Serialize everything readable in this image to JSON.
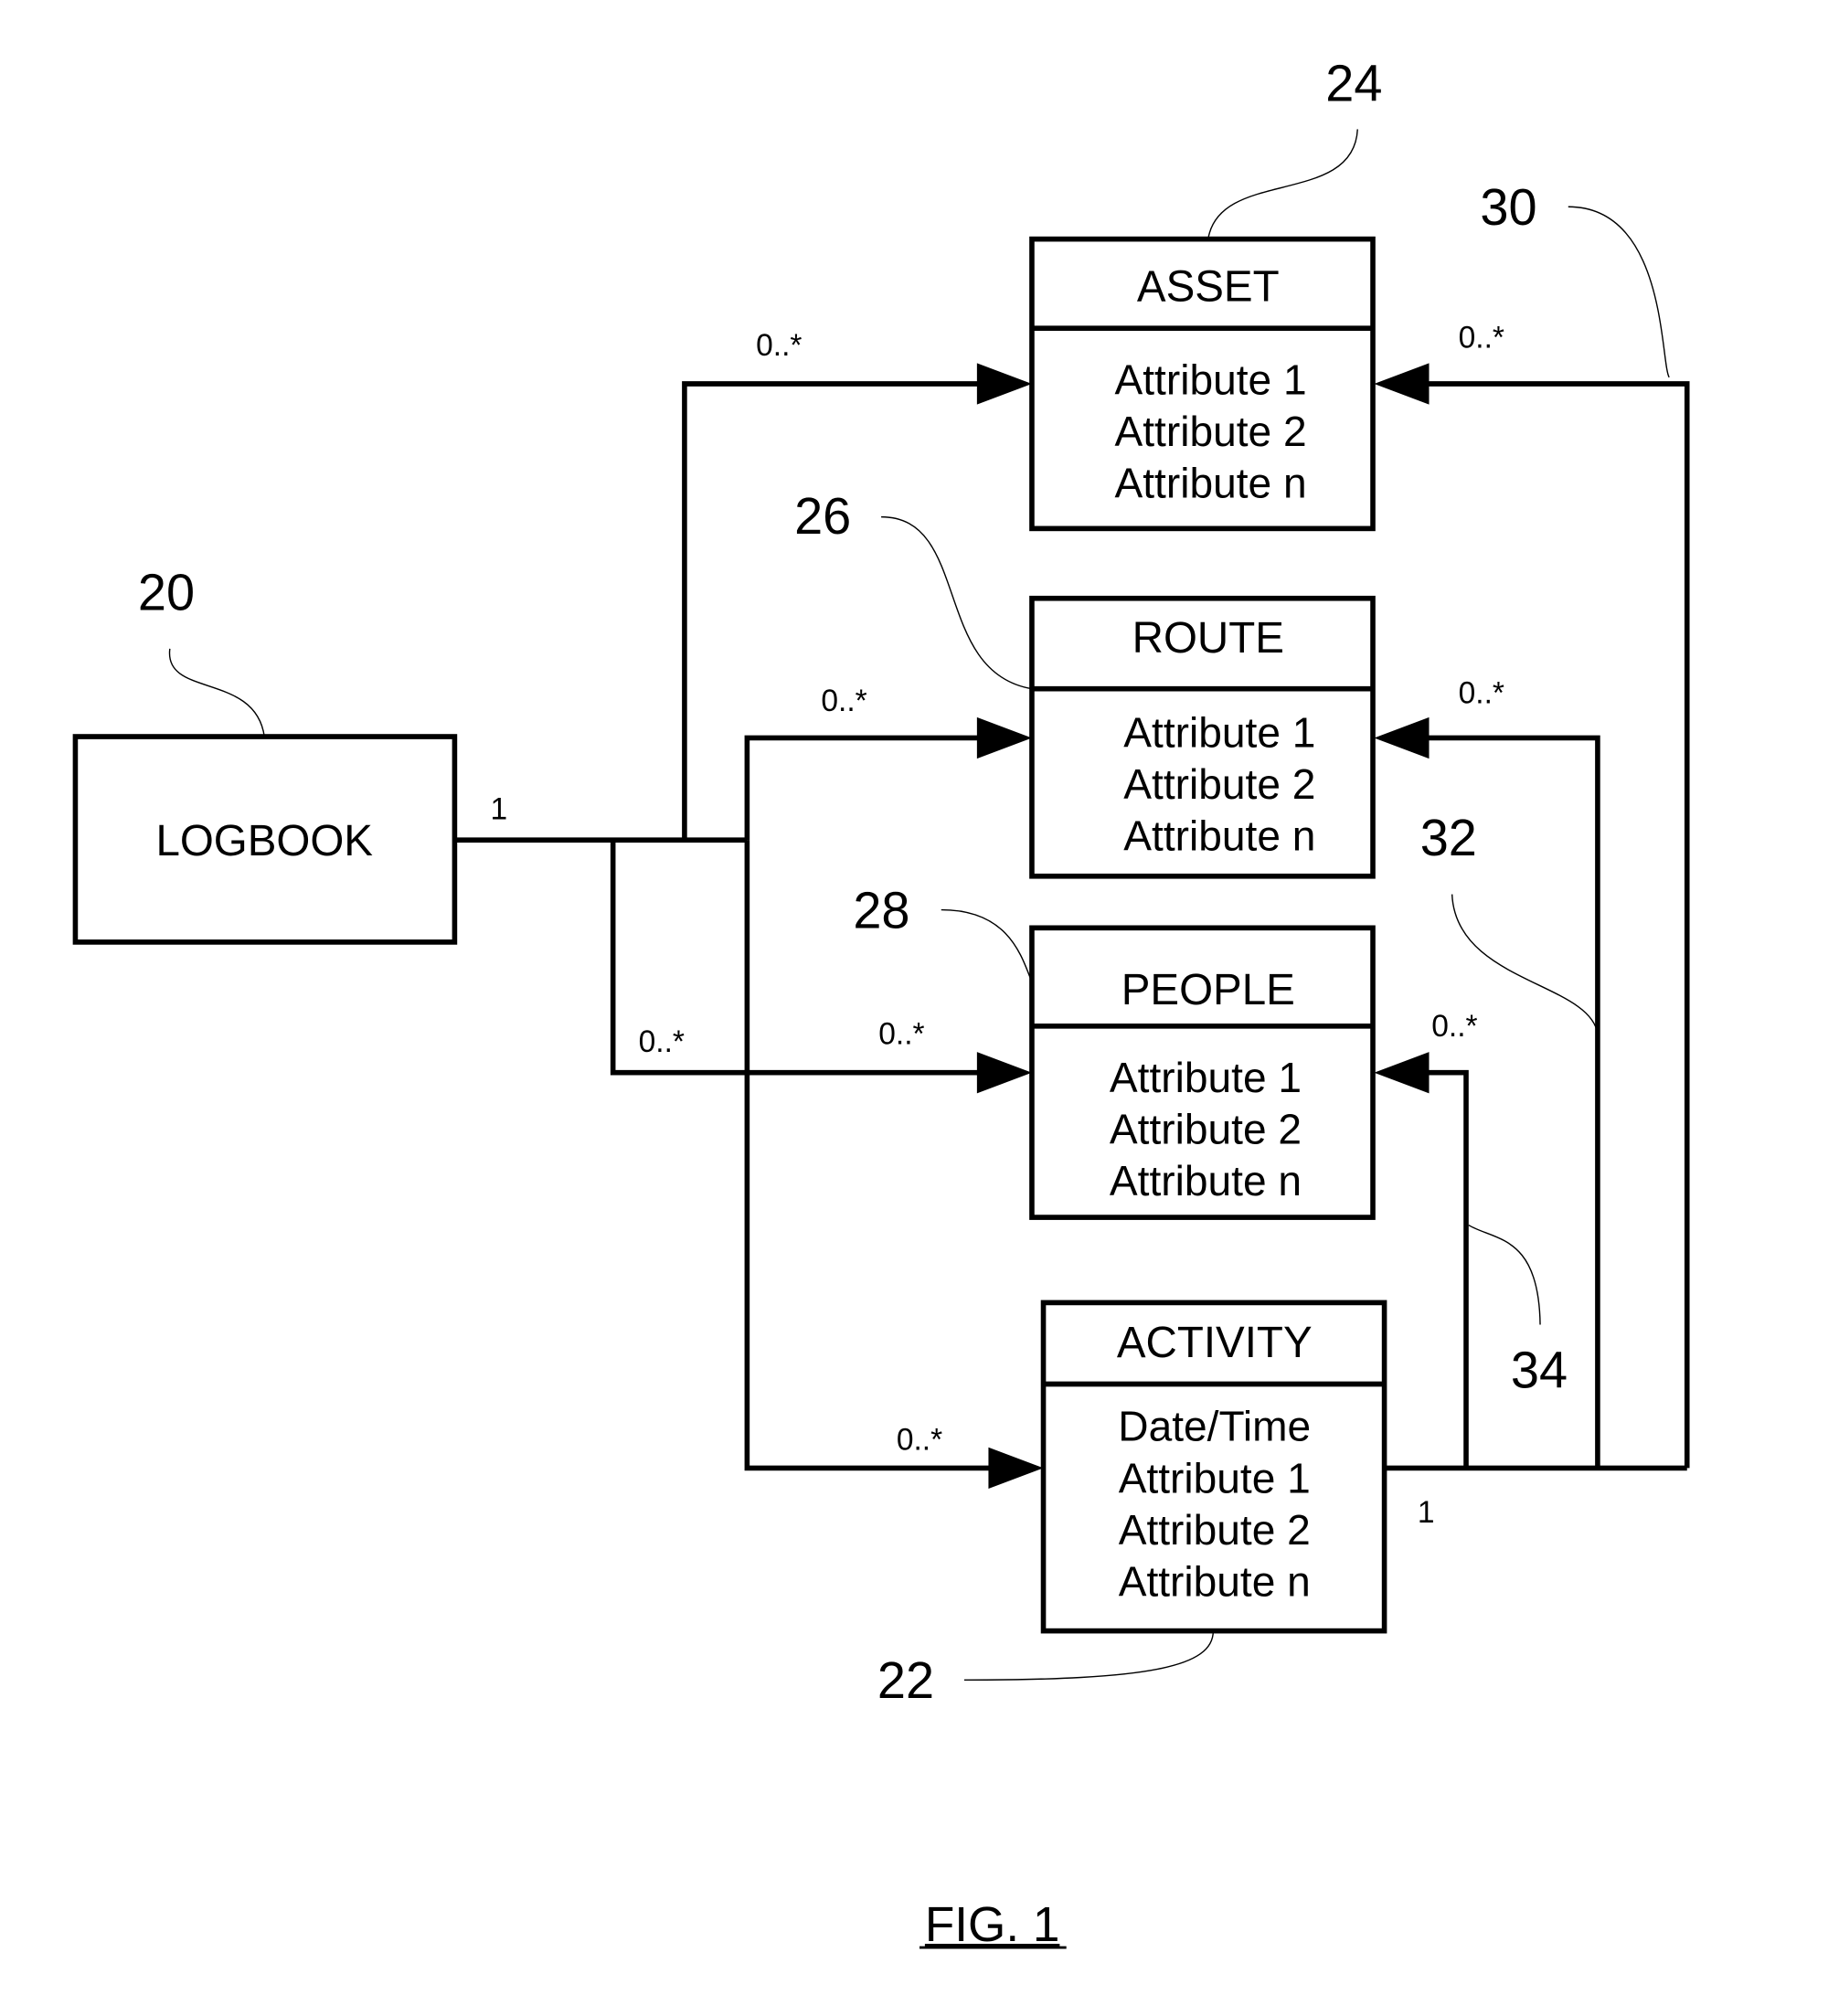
{
  "figure": {
    "caption": "FIG. 1"
  },
  "entities": {
    "logbook": {
      "ref": "20",
      "title": "LOGBOOK",
      "attributes": []
    },
    "activity": {
      "ref": "22",
      "title": "ACTIVITY",
      "attributes": [
        "Date/Time",
        "Attribute 1",
        "Attribute 2",
        "Attribute n"
      ]
    },
    "asset": {
      "ref": "24",
      "title": "ASSET",
      "attributes": [
        "Attribute 1",
        "Attribute 2",
        "Attribute n"
      ]
    },
    "route": {
      "ref": "26",
      "title": "ROUTE",
      "attributes": [
        "Attribute 1",
        "Attribute 2",
        "Attribute n"
      ]
    },
    "people": {
      "ref": "28",
      "title": "PEOPLE",
      "attributes": [
        "Attribute 1",
        "Attribute 2",
        "Attribute n"
      ]
    }
  },
  "relationships": {
    "logbook_side_multiplicity": "1",
    "logbook_to_asset": "0..*",
    "logbook_to_route": "0..*",
    "logbook_to_people_a": "0..*",
    "logbook_to_people_b": "0..*",
    "logbook_to_activity": "0..*",
    "activity_side_multiplicity": "1",
    "activity_to_asset": {
      "ref": "30",
      "multiplicity": "0..*"
    },
    "activity_to_route": {
      "ref": "32",
      "multiplicity": "0..*"
    },
    "activity_to_people": {
      "ref": "34",
      "multiplicity": "0..*"
    }
  }
}
